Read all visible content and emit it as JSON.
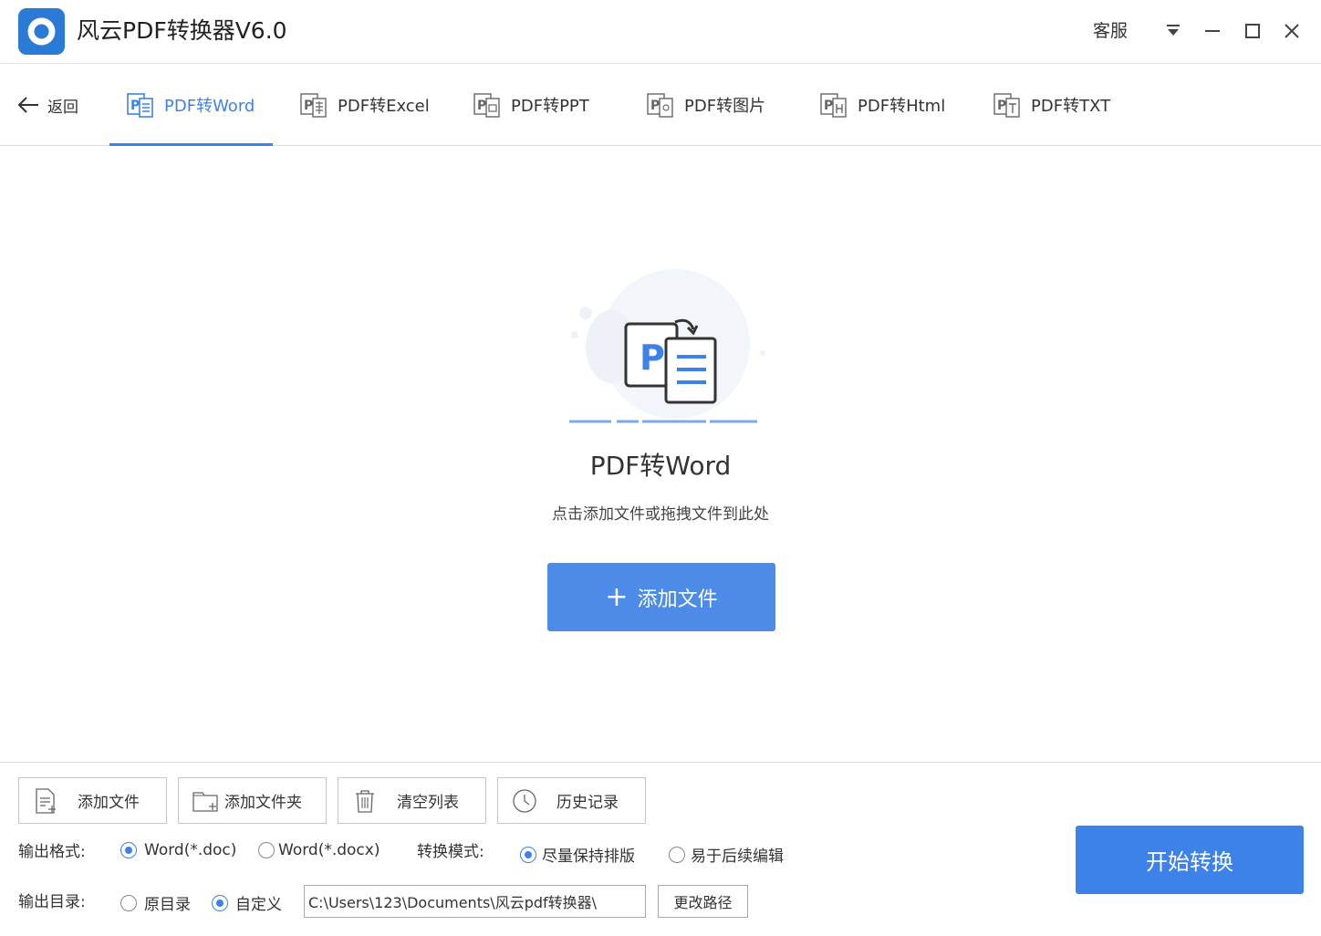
{
  "app": {
    "title": "风云PDF转换器V6.0",
    "service_label": "客服",
    "accent_color": "#3d82e8"
  },
  "nav": {
    "back_label": "返回",
    "tabs": [
      {
        "label": "PDF转Word",
        "icon": "pdf-word-icon",
        "active": true
      },
      {
        "label": "PDF转Excel",
        "icon": "pdf-excel-icon",
        "active": false
      },
      {
        "label": "PDF转PPT",
        "icon": "pdf-ppt-icon",
        "active": false
      },
      {
        "label": "PDF转图片",
        "icon": "pdf-image-icon",
        "active": false
      },
      {
        "label": "PDF转Html",
        "icon": "pdf-html-icon",
        "active": false
      },
      {
        "label": "PDF转TXT",
        "icon": "pdf-txt-icon",
        "active": false
      }
    ]
  },
  "main": {
    "title": "PDF转Word",
    "tip": "点击添加文件或拖拽文件到此处",
    "add_button_label": "添加文件"
  },
  "toolbar": {
    "add_file": "添加文件",
    "add_folder": "添加文件夹",
    "clear_list": "清空列表",
    "history": "历史记录"
  },
  "options": {
    "output_format_label": "输出格式:",
    "format_doc": "Word(*.doc)",
    "format_docx": "Word(*.docx)",
    "format_selected": "doc",
    "mode_label": "转换模式:",
    "mode_keep_layout": "尽量保持排版",
    "mode_easy_edit": "易于后续编辑",
    "mode_selected": "keep_layout",
    "output_dir_label": "输出目录:",
    "dir_original": "原目录",
    "dir_custom": "自定义",
    "dir_selected": "custom",
    "output_path": "C:\\Users\\123\\Documents\\风云pdf转换器\\",
    "change_path_label": "更改路径"
  },
  "start_button_label": "开始转换"
}
